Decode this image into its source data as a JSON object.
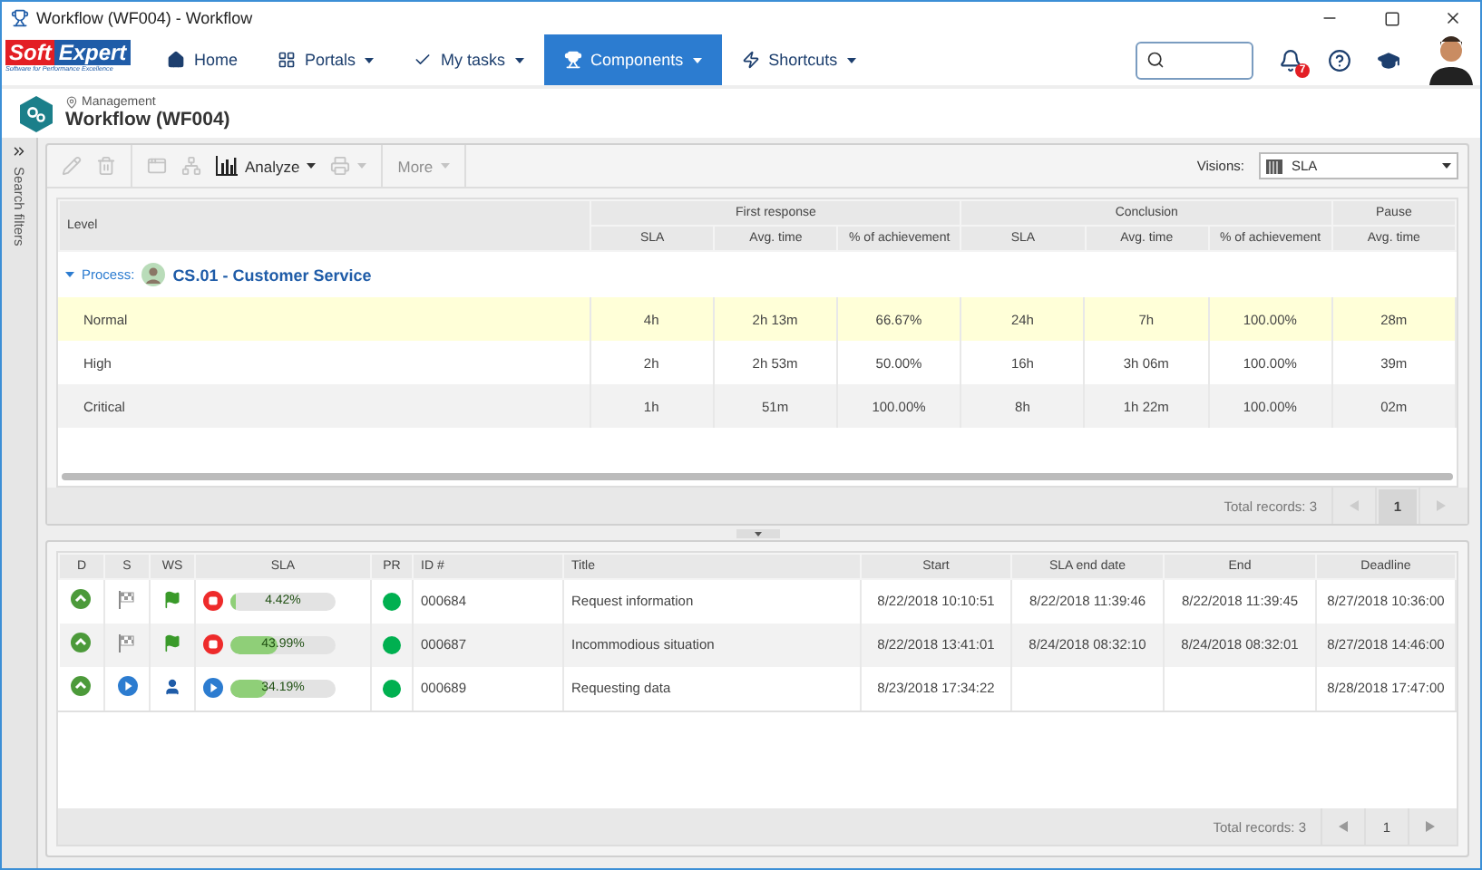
{
  "window": {
    "title": "Workflow (WF004) - Workflow"
  },
  "logo": {
    "first": "Soft",
    "second": "Expert",
    "tagline": "Software for Performance Excellence"
  },
  "nav": [
    {
      "label": "Home",
      "dropdown": false,
      "selected": false
    },
    {
      "label": "Portals",
      "dropdown": true,
      "selected": false
    },
    {
      "label": "My tasks",
      "dropdown": true,
      "selected": false
    },
    {
      "label": "Components",
      "dropdown": true,
      "selected": true
    },
    {
      "label": "Shortcuts",
      "dropdown": true,
      "selected": false
    }
  ],
  "notifications": {
    "count": "7"
  },
  "header": {
    "breadcrumb": "Management",
    "title": "Workflow (WF004)"
  },
  "sidebar": {
    "label": "Search filters"
  },
  "toolbar": {
    "edit": {
      "disabled": true
    },
    "delete": {
      "disabled": true
    },
    "view": {
      "disabled": true
    },
    "flow": {
      "disabled": true
    },
    "analyze": {
      "label": "Analyze",
      "disabled": false
    },
    "print": {
      "disabled": true
    },
    "more": {
      "label": "More",
      "disabled": true
    }
  },
  "visions": {
    "label": "Visions:",
    "value": "SLA"
  },
  "sla_table": {
    "level_heading": "Level",
    "groups": [
      {
        "label": "First response",
        "columns": [
          "SLA",
          "Avg. time",
          "% of achievement"
        ]
      },
      {
        "label": "Conclusion",
        "columns": [
          "SLA",
          "Avg. time",
          "% of achievement"
        ]
      },
      {
        "label": "Pause",
        "columns": [
          "Avg. time"
        ]
      }
    ],
    "process": {
      "prefix": "Process:",
      "name": "CS.01 - Customer Service",
      "expanded": true
    },
    "rows": [
      {
        "level": "Normal",
        "selected": true,
        "cells": [
          "4h",
          "2h 13m",
          "66.67%",
          "24h",
          "7h",
          "100.00%",
          "28m"
        ]
      },
      {
        "level": "High",
        "selected": false,
        "cells": [
          "2h",
          "2h 53m",
          "50.00%",
          "16h",
          "3h 06m",
          "100.00%",
          "39m"
        ]
      },
      {
        "level": "Critical",
        "selected": false,
        "cells": [
          "1h",
          "51m",
          "100.00%",
          "8h",
          "1h 22m",
          "100.00%",
          "02m"
        ]
      }
    ],
    "total": "Total records: 3",
    "page": "1"
  },
  "tasks": {
    "columns": [
      "D",
      "S",
      "WS",
      "SLA",
      "PR",
      "ID #",
      "Title",
      "Start",
      "SLA end date",
      "End",
      "Deadline"
    ],
    "rows": [
      {
        "s": {
          "kind": "finished"
        },
        "ws": {
          "kind": "flag"
        },
        "sla": {
          "kind": "stopped",
          "level": 0.0442,
          "reading": "4.42%"
        },
        "pr": {
          "color": "#00b050"
        },
        "id": "000684",
        "title": "Request information",
        "start": "8/22/2018 10:10:51",
        "sla_end": "8/22/2018 11:39:46",
        "end": "8/22/2018 11:39:45",
        "deadline": "8/27/2018 10:36:00"
      },
      {
        "s": {
          "kind": "finished"
        },
        "ws": {
          "kind": "flag"
        },
        "sla": {
          "kind": "stopped",
          "level": 0.4399,
          "reading": "43.99%"
        },
        "pr": {
          "color": "#00b050"
        },
        "id": "000687",
        "title": "Incommodious situation",
        "start": "8/22/2018 13:41:01",
        "sla_end": "8/24/2018 08:32:10",
        "end": "8/24/2018 08:32:01",
        "deadline": "8/27/2018 14:46:00"
      },
      {
        "s": {
          "kind": "running"
        },
        "ws": {
          "kind": "user"
        },
        "sla": {
          "kind": "running",
          "level": 0.3419,
          "reading": "34.19%"
        },
        "pr": {
          "color": "#00b050"
        },
        "id": "000689",
        "title": "Requesting data",
        "start": "8/23/2018 17:34:22",
        "deadline": "8/28/2018 17:47:00"
      }
    ],
    "total": "Total records: 3",
    "page": "1"
  }
}
